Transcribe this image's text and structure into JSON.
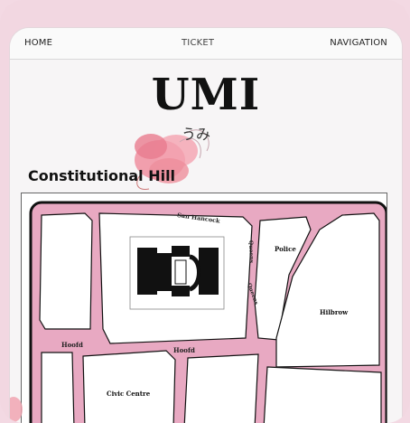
{
  "nav": {
    "home": "HOME",
    "ticket": "TICKET",
    "navigation": "NAVIGATION"
  },
  "brand": {
    "title": "UMI",
    "subtitle": "うみ"
  },
  "section": {
    "title": "Constitutional Hill"
  },
  "map": {
    "streets": {
      "san_hancock": "San Hancock",
      "queens": "Queens",
      "hoofd_left": "Hoofd",
      "hoofd_mid": "Hoofd"
    },
    "places": {
      "police": "Police",
      "hilbrow": "Hilbrow",
      "civic_centre": "Civic Centre"
    },
    "colors": {
      "road": "#e8a9c2",
      "block": "#ffffff",
      "outline": "#111111"
    }
  }
}
